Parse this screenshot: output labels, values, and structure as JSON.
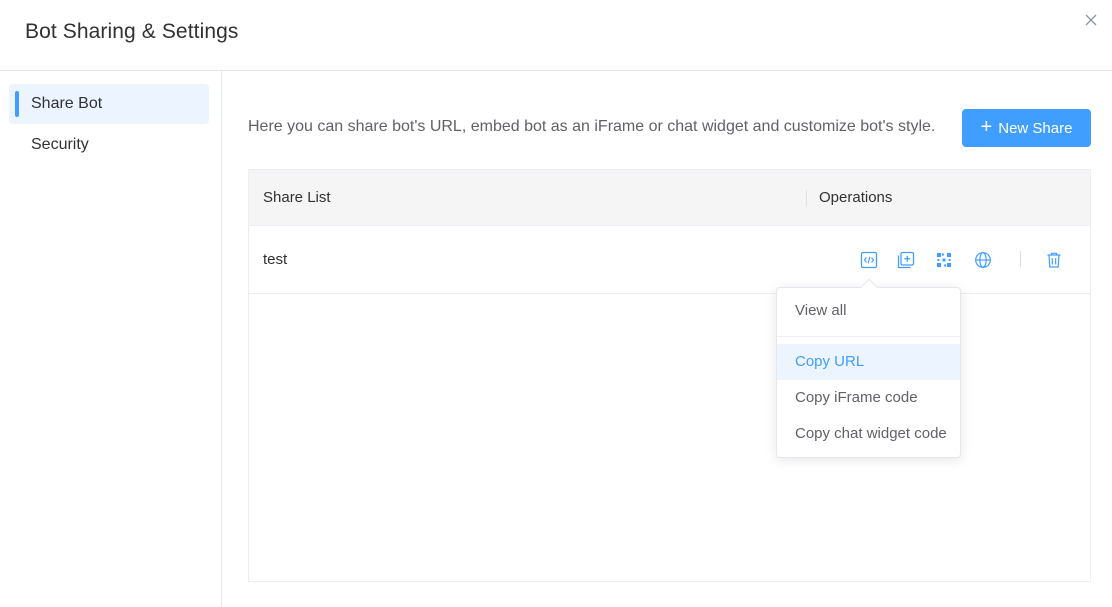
{
  "dialog": {
    "title": "Bot Sharing & Settings",
    "close_icon": "close-icon"
  },
  "sidebar": {
    "items": [
      {
        "label": "Share Bot",
        "active": true
      },
      {
        "label": "Security",
        "active": false
      }
    ]
  },
  "main": {
    "description": "Here you can share bot's URL, embed bot as an iFrame or chat widget and customize bot's style.",
    "new_share_label": "New Share",
    "table": {
      "columns": [
        "Share List",
        "Operations"
      ],
      "rows": [
        {
          "name": "test",
          "operations": [
            "embed-code-icon",
            "copy-icon",
            "qr-code-icon",
            "globe-icon",
            "delete-icon"
          ]
        }
      ]
    }
  },
  "dropdown": {
    "items": [
      "View all",
      "Copy URL",
      "Copy iFrame code",
      "Copy chat widget code"
    ],
    "highlighted": "Copy URL"
  },
  "colors": {
    "accent": "#409eff",
    "accent_light": "#ecf5ff",
    "header_bg": "#f5f5f5",
    "border": "#ebeef5"
  }
}
